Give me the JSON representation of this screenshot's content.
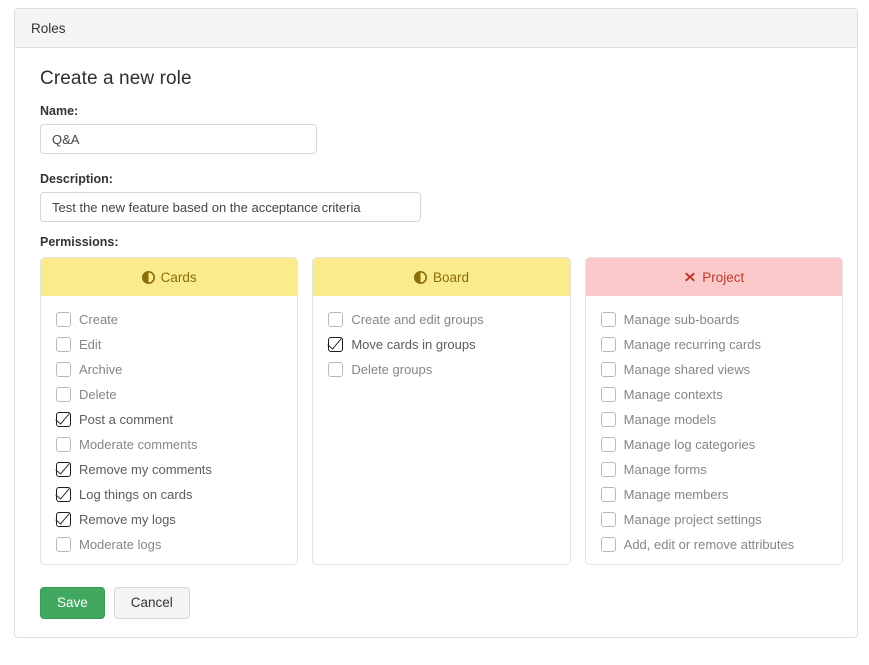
{
  "window": {
    "tab_title": "Roles"
  },
  "form": {
    "title": "Create a new role",
    "name_label": "Name:",
    "name_value": "Q&A",
    "name_placeholder": "",
    "description_label": "Description:",
    "description_value": "Test the new feature based on the acceptance criteria",
    "description_placeholder": "",
    "permissions_label": "Permissions:"
  },
  "colors": {
    "cards_header_bg": "#faec8c",
    "cards_header_text": "#8a6d09",
    "board_header_bg": "#faec8c",
    "board_header_text": "#8a6d09",
    "project_header_bg": "#fbc9c9",
    "project_header_text": "#c0392b",
    "save_button_bg": "#41a85f"
  },
  "permission_groups": [
    {
      "title": "Cards",
      "icon": "contrast-icon",
      "items": [
        {
          "label": "Create",
          "checked": false
        },
        {
          "label": "Edit",
          "checked": false
        },
        {
          "label": "Archive",
          "checked": false
        },
        {
          "label": "Delete",
          "checked": false
        },
        {
          "label": "Post a comment",
          "checked": true
        },
        {
          "label": "Moderate comments",
          "checked": false
        },
        {
          "label": "Remove my comments",
          "checked": true
        },
        {
          "label": "Log things on cards",
          "checked": true
        },
        {
          "label": "Remove my logs",
          "checked": true
        },
        {
          "label": "Moderate logs",
          "checked": false
        }
      ]
    },
    {
      "title": "Board",
      "icon": "contrast-icon",
      "items": [
        {
          "label": "Create and edit groups",
          "checked": false
        },
        {
          "label": "Move cards in groups",
          "checked": true
        },
        {
          "label": "Delete groups",
          "checked": false
        }
      ]
    },
    {
      "title": "Project",
      "icon": "cross-icon",
      "items": [
        {
          "label": "Manage sub-boards",
          "checked": false
        },
        {
          "label": "Manage recurring cards",
          "checked": false
        },
        {
          "label": "Manage shared views",
          "checked": false
        },
        {
          "label": "Manage contexts",
          "checked": false
        },
        {
          "label": "Manage models",
          "checked": false
        },
        {
          "label": "Manage log categories",
          "checked": false
        },
        {
          "label": "Manage forms",
          "checked": false
        },
        {
          "label": "Manage members",
          "checked": false
        },
        {
          "label": "Manage project settings",
          "checked": false
        },
        {
          "label": "Add, edit or remove attributes",
          "checked": false
        }
      ]
    }
  ],
  "footer": {
    "save_label": "Save",
    "cancel_label": "Cancel"
  }
}
